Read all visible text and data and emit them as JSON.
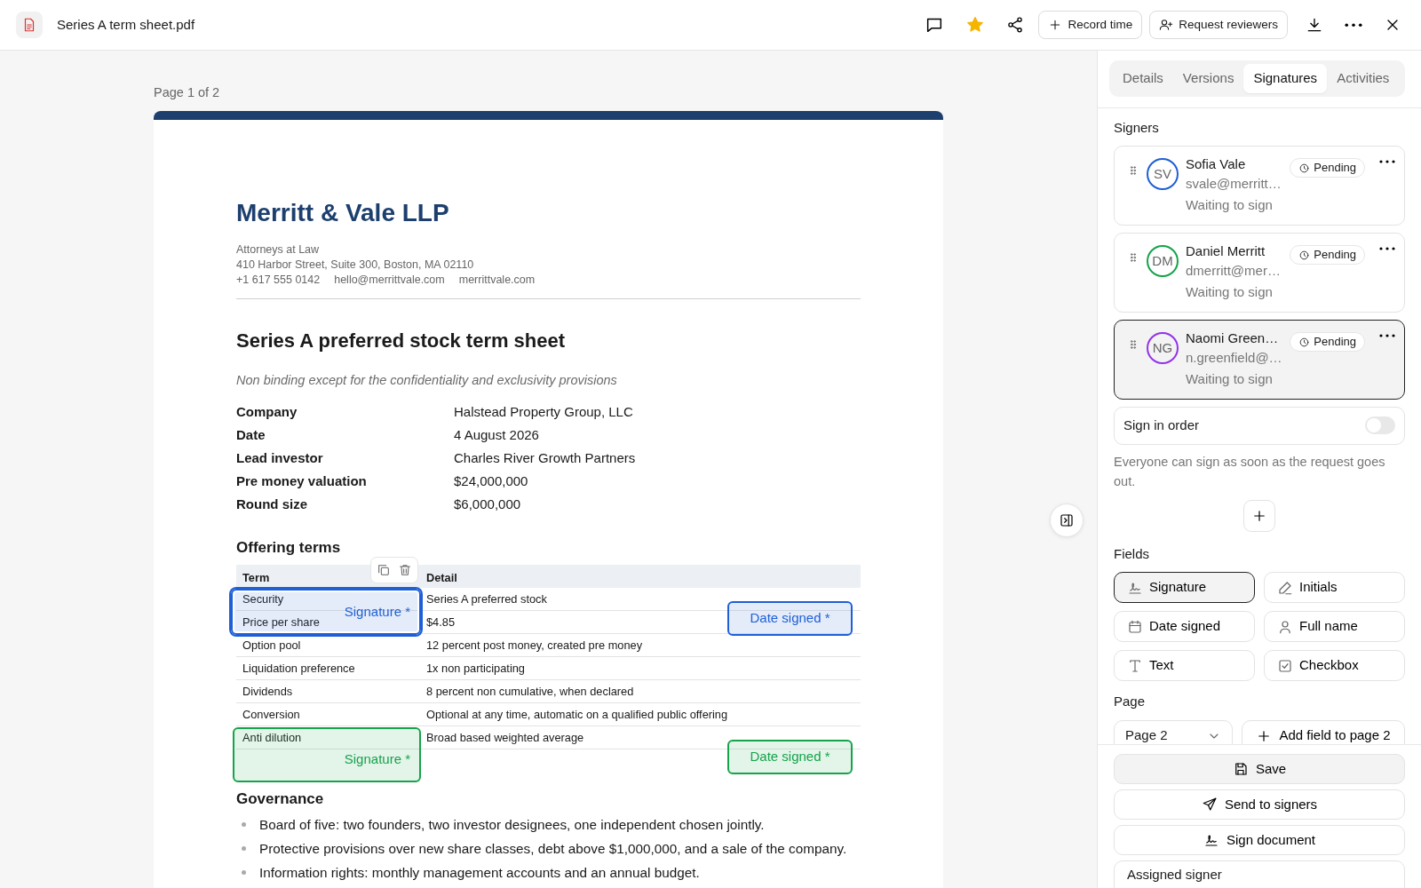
{
  "header": {
    "file_name": "Series A term sheet.pdf",
    "starred": true,
    "buttons": [
      {
        "label": "Record time",
        "kind": "record"
      },
      {
        "label": "Request reviewers",
        "kind": "reviewers"
      }
    ]
  },
  "viewer": {
    "page_label": "Page 1 of 2",
    "firm": {
      "name": "Merritt & Vale LLP",
      "tagline": "Attorneys at Law",
      "address": "410 Harbor Street, Suite 300, Boston, MA 02110",
      "contact": [
        "+1 617 555 0142",
        "hello@merrittvale.com",
        "merrittvale.com"
      ]
    },
    "title": "Series A preferred stock term sheet",
    "subtitle": "Non binding except for the confidentiality and exclusivity provisions",
    "facts": [
      {
        "label": "Company",
        "value": "Halstead Property Group, LLC"
      },
      {
        "label": "Date",
        "value": "4 August 2026"
      },
      {
        "label": "Lead investor",
        "value": "Charles River Growth Partners"
      },
      {
        "label": "Pre money valuation",
        "value": "$24,000,000"
      },
      {
        "label": "Round size",
        "value": "$6,000,000"
      }
    ],
    "offering_heading": "Offering terms",
    "table": {
      "columns": [
        "Term",
        "Detail"
      ],
      "rows": [
        [
          "Security",
          "Series A preferred stock"
        ],
        [
          "Price per share",
          "$4.85"
        ],
        [
          "Option pool",
          "12 percent post money, created pre money"
        ],
        [
          "Liquidation preference",
          "1x non participating"
        ],
        [
          "Dividends",
          "8 percent non cumulative, when declared"
        ],
        [
          "Conversion",
          "Optional at any time, automatic on a qualified public offering"
        ],
        [
          "Anti dilution",
          "Broad based weighted average"
        ]
      ]
    },
    "governance_heading": "Governance",
    "bullets": [
      "Board of five: two founders, two investor designees, one independent chosen jointly.",
      "Protective provisions over new share classes, debt above $1,000,000, and a sale of the company.",
      "Information rights: monthly management accounts and an annual budget."
    ],
    "fields": [
      {
        "kind": "signature",
        "label": "Signature *",
        "color": "#1f5fd6",
        "selected": true
      },
      {
        "kind": "date",
        "label": "Date signed *",
        "color": "#1f5fd6",
        "selected": false
      },
      {
        "kind": "signature",
        "label": "Signature *",
        "color": "#16a34a",
        "selected": false
      },
      {
        "kind": "date",
        "label": "Date signed *",
        "color": "#16a34a",
        "selected": false
      }
    ]
  },
  "sidebar": {
    "tabs": [
      {
        "label": "Details",
        "selected": false
      },
      {
        "label": "Versions",
        "selected": false
      },
      {
        "label": "Signatures",
        "selected": true
      },
      {
        "label": "Activities",
        "selected": false
      }
    ],
    "signers_heading": "Signers",
    "signers": [
      {
        "initials": "SV",
        "name": "Sofia Vale",
        "email": "svale@merritt…",
        "status": "Waiting to sign",
        "badge": "Pending",
        "color": "#1f5fd6",
        "selected": false
      },
      {
        "initials": "DM",
        "name": "Daniel Merritt",
        "email": "dmerritt@mer…",
        "status": "Waiting to sign",
        "badge": "Pending",
        "color": "#16a34a",
        "selected": false
      },
      {
        "initials": "NG",
        "name": "Naomi Green…",
        "email": "n.greenfield@…",
        "status": "Waiting to sign",
        "badge": "Pending",
        "color": "#9333ea",
        "selected": true
      }
    ],
    "sign_in_order": {
      "label": "Sign in order",
      "on": false
    },
    "hint": "Everyone can sign as soon as the request goes out.",
    "fields_heading": "Fields",
    "field_types": [
      {
        "label": "Signature",
        "kind": "signature",
        "selected": true
      },
      {
        "label": "Initials",
        "kind": "initials",
        "selected": false
      },
      {
        "label": "Date signed",
        "kind": "date",
        "selected": false
      },
      {
        "label": "Full name",
        "kind": "name",
        "selected": false
      },
      {
        "label": "Text",
        "kind": "text",
        "selected": false
      },
      {
        "label": "Checkbox",
        "kind": "checkbox",
        "selected": false
      }
    ],
    "page_heading": "Page",
    "page_select": "Page 2",
    "add_button": "Add field to page 2",
    "actions": [
      {
        "label": "Save",
        "kind": "save"
      },
      {
        "label": "Send to signers",
        "kind": "send"
      },
      {
        "label": "Sign document",
        "kind": "sign"
      }
    ],
    "assigned_signer": "Assigned signer"
  }
}
